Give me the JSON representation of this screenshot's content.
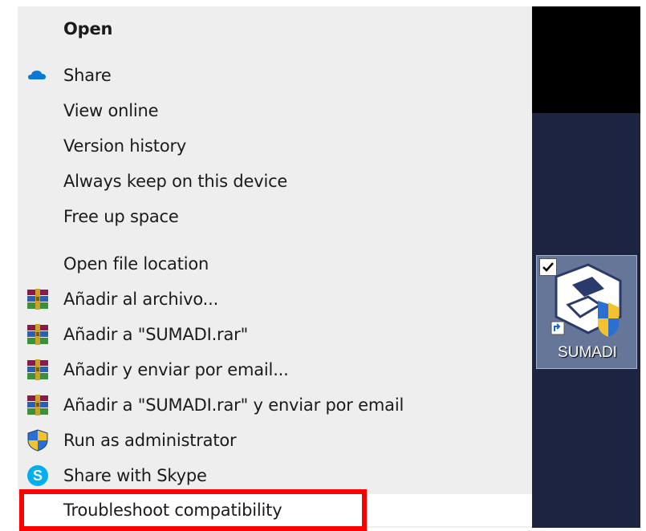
{
  "context_menu": {
    "items": [
      {
        "label": "Open",
        "bold": true,
        "icon": ""
      },
      {
        "label": "Share",
        "bold": false,
        "icon": "onedrive-cloud-icon"
      },
      {
        "label": "View online",
        "bold": false,
        "icon": ""
      },
      {
        "label": "Version history",
        "bold": false,
        "icon": ""
      },
      {
        "label": "Always keep on this device",
        "bold": false,
        "icon": ""
      },
      {
        "label": "Free up space",
        "bold": false,
        "icon": ""
      },
      {
        "label": "Open file location",
        "bold": false,
        "icon": ""
      },
      {
        "label": "Añadir al archivo...",
        "bold": false,
        "icon": "winrar-icon"
      },
      {
        "label": "Añadir a \"SUMADI.rar\"",
        "bold": false,
        "icon": "winrar-icon"
      },
      {
        "label": "Añadir y enviar por email...",
        "bold": false,
        "icon": "winrar-icon"
      },
      {
        "label": "Añadir a \"SUMADI.rar\" y enviar por email",
        "bold": false,
        "icon": "winrar-icon"
      },
      {
        "label": "Run as administrator",
        "bold": false,
        "icon": "uac-shield-icon"
      },
      {
        "label": "Share with Skype",
        "bold": false,
        "icon": "skype-icon"
      },
      {
        "label": "Troubleshoot compatibility",
        "bold": false,
        "icon": ""
      }
    ]
  },
  "desktop": {
    "icon_label": "SUMADI",
    "icon": "sumadi-app-icon"
  },
  "colors": {
    "menu_bg": "#eeeeee",
    "highlight_box": "#ff0000",
    "desktop_bg": "#1d2441",
    "onedrive_blue": "#0a78d4",
    "skype_blue": "#00aff0"
  }
}
